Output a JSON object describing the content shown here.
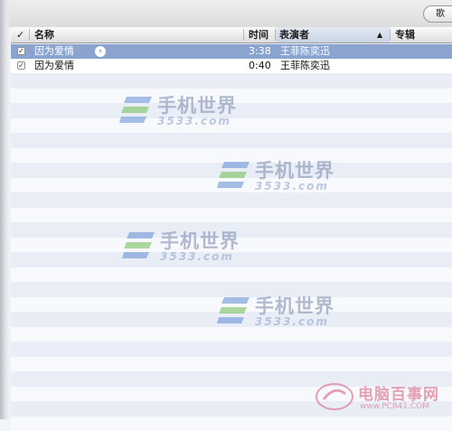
{
  "toolbar": {
    "pill_label": "歌"
  },
  "columns": {
    "check": "✓",
    "name": "名称",
    "time": "时间",
    "artist": "表演者",
    "sort_indicator": "▲",
    "album": "专辑"
  },
  "tracks": [
    {
      "checked": "✓",
      "name": "因为爱情",
      "time": "3:38",
      "artist": "王菲陈奕迅",
      "selected": true,
      "detail_arrow": "›"
    },
    {
      "checked": "✓",
      "name": "因为爱情",
      "time": "0:40",
      "artist": "王菲陈奕迅",
      "selected": false
    }
  ],
  "watermarks": {
    "main_text": "手机世界",
    "main_sub": "3533.com",
    "corner_text": "电脑百事网",
    "corner_sub": "www.PC841.COM"
  },
  "colors": {
    "selected_row": "#8aa4cf",
    "stripe_blue": "#e9eef6",
    "stripe_white": "#f7f9fc"
  }
}
